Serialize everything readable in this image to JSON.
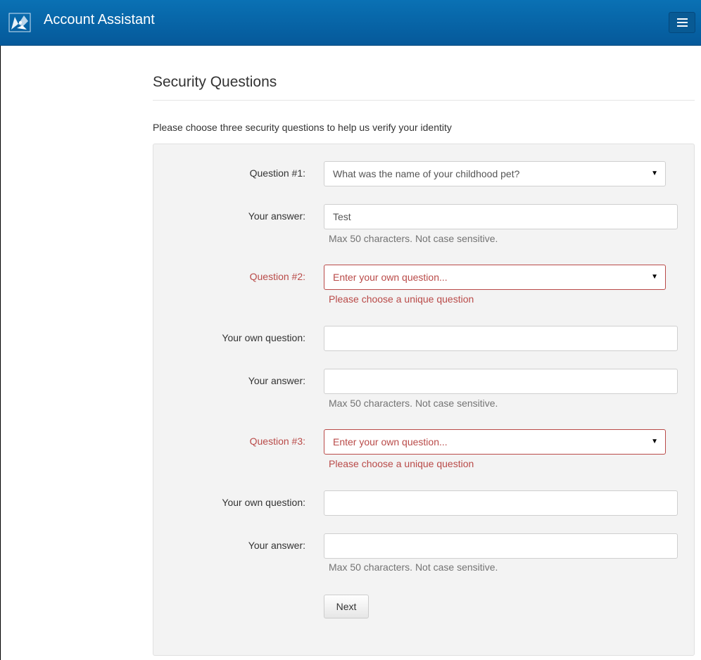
{
  "header": {
    "brand": "Account Assistant",
    "logo_icon": "butterfly-logo-icon",
    "menu_icon": "hamburger-menu-icon",
    "colors": {
      "navbar": "#05599a",
      "error": "#b94a48"
    }
  },
  "page": {
    "title": "Security Questions",
    "intro": "Please choose three security questions to help us verify your identity"
  },
  "form": {
    "q1": {
      "label": "Question #1:",
      "selected": "What was the name of your childhood pet?"
    },
    "a1": {
      "label": "Your answer:",
      "value": "Test",
      "help": "Max 50 characters. Not case sensitive."
    },
    "q2": {
      "label": "Question #2:",
      "selected": "Enter your own question...",
      "error": "Please choose a unique question"
    },
    "own2": {
      "label": "Your own question:",
      "value": ""
    },
    "a2": {
      "label": "Your answer:",
      "value": "",
      "help": "Max 50 characters. Not case sensitive."
    },
    "q3": {
      "label": "Question #3:",
      "selected": "Enter your own question...",
      "error": "Please choose a unique question"
    },
    "own3": {
      "label": "Your own question:",
      "value": ""
    },
    "a3": {
      "label": "Your answer:",
      "value": "",
      "help": "Max 50 characters. Not case sensitive."
    },
    "next_label": "Next"
  }
}
